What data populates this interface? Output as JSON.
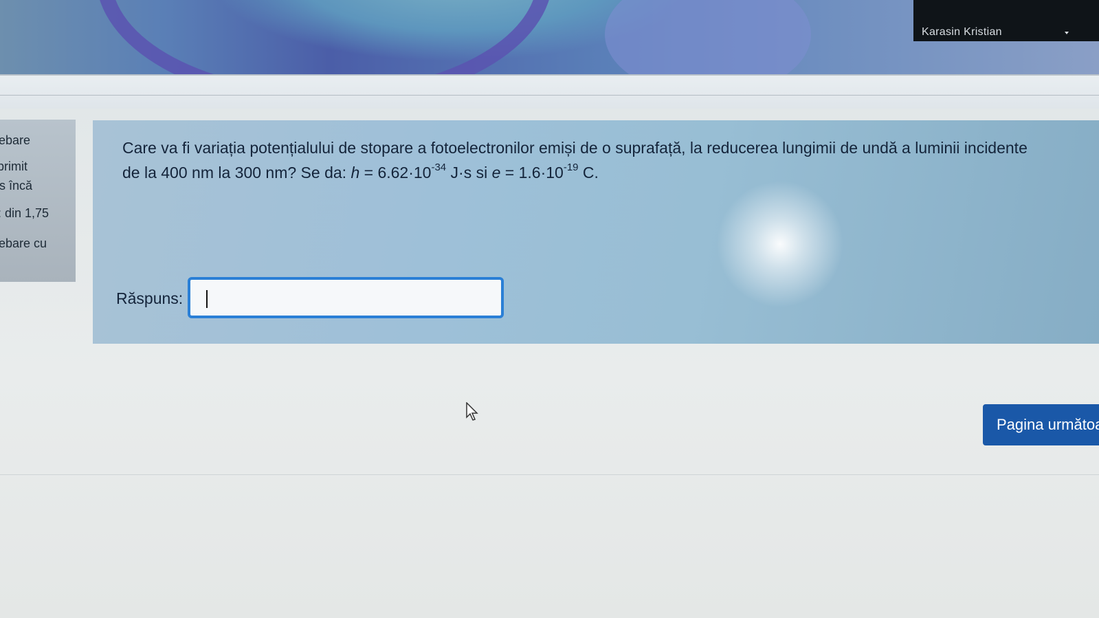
{
  "header": {
    "user_name": "Karasin Kristian"
  },
  "sidebar": {
    "lines": [
      "ebare",
      "primit",
      "ıs încă",
      ": din 1,75",
      "ebare cu"
    ]
  },
  "question": {
    "line1": "Care va fi variația potențialului de stopare a fotoelectronilor emiși de o suprafață, la reducerea lungimii de undă a luminii incidente",
    "line2_prefix": "de la 400 nm la 300 nm? Se da: ",
    "h_symbol": "h",
    "h_value": " = 6.62·10",
    "h_exponent": "-34",
    "h_unit": " J·s si ",
    "e_symbol": "e",
    "e_value": " = 1.6·10",
    "e_exponent": "-19",
    "e_unit": " C."
  },
  "answer": {
    "label": "Răspuns:",
    "value": ""
  },
  "navigation": {
    "next_label": "Pagina următoare"
  },
  "colors": {
    "accent": "#2a7fd6",
    "button": "#1a58a8",
    "question_bg": "#9ec0d8"
  }
}
